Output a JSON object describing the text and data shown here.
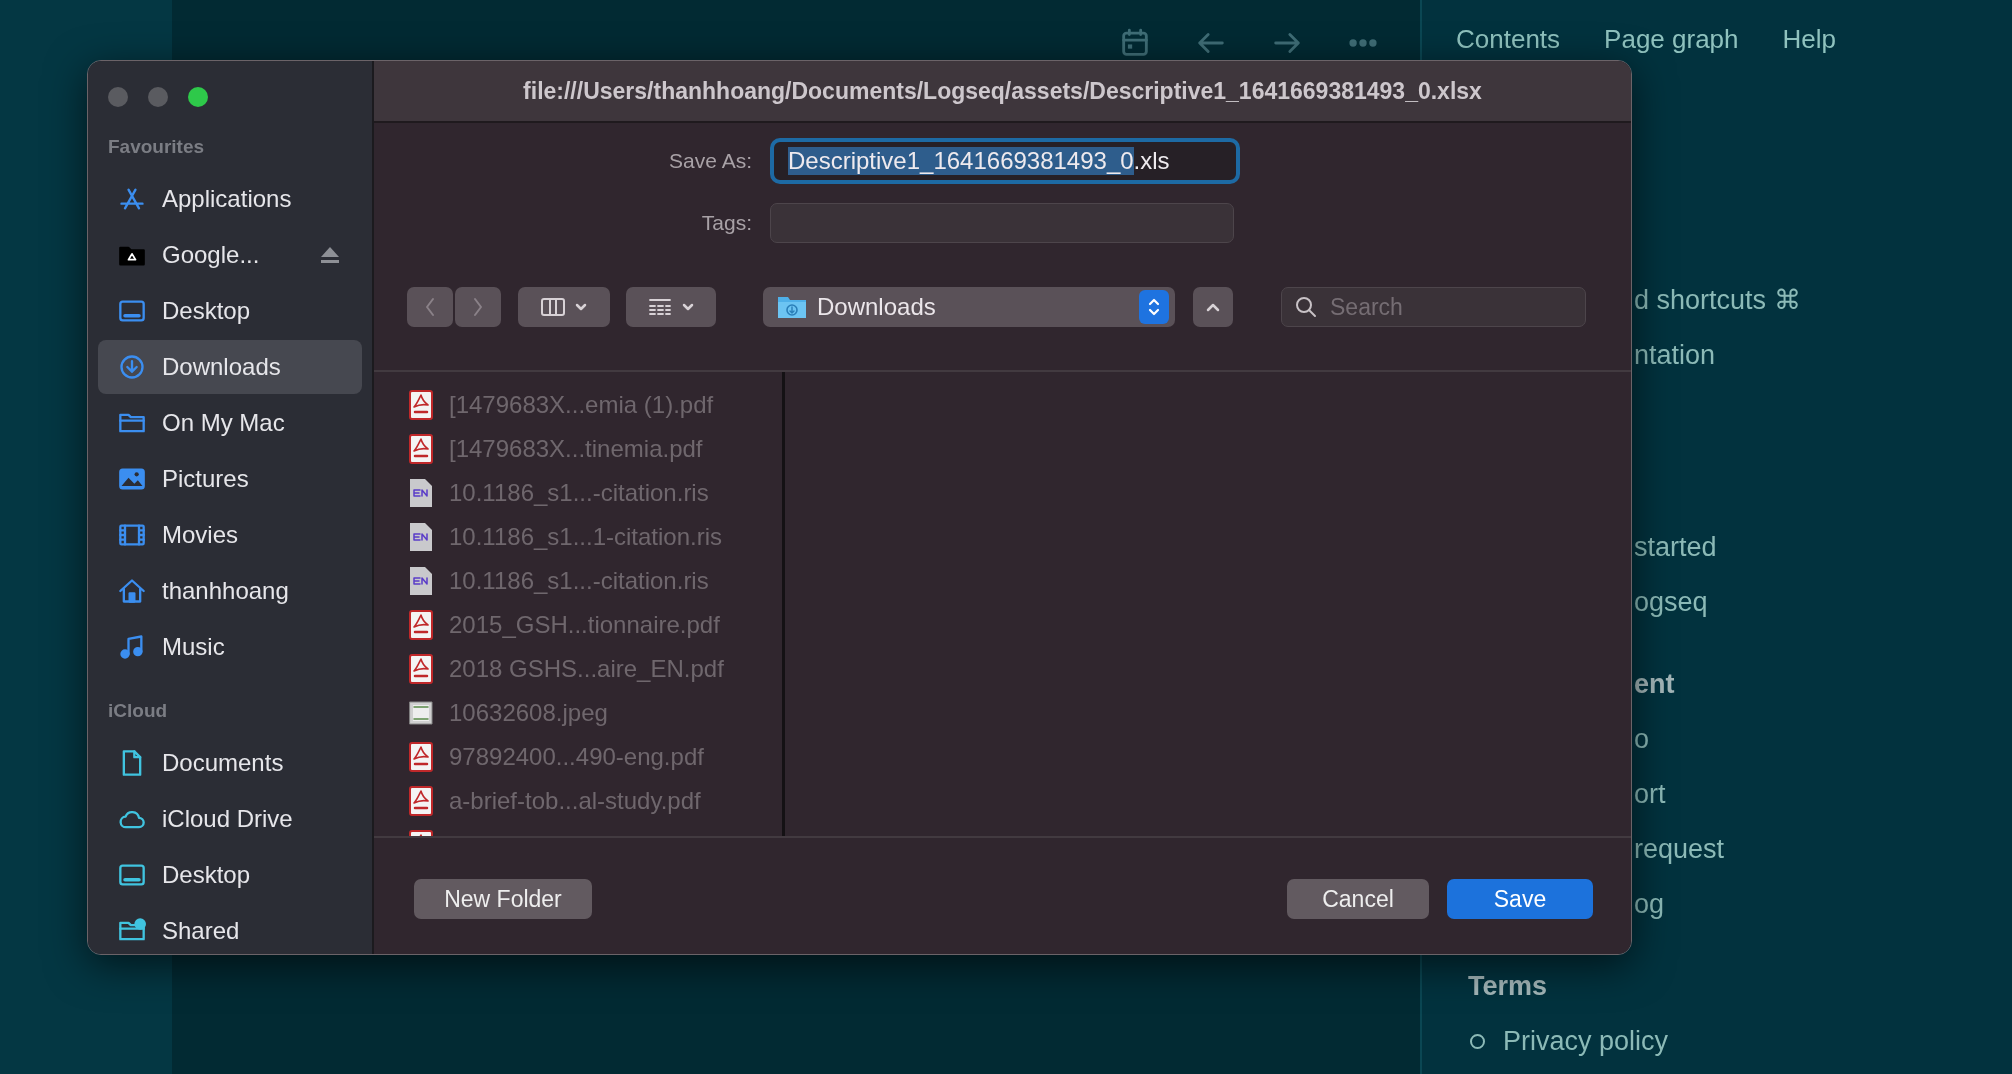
{
  "app_nav": [
    "Contents",
    "Page graph",
    "Help"
  ],
  "help_panel": {
    "sections": [
      {
        "items": [
          {
            "text": "d shortcuts ⌘",
            "kind": "partial"
          },
          {
            "text": "ntation",
            "kind": "partial"
          }
        ]
      },
      {
        "items": [
          {
            "text": "started",
            "kind": "partial"
          },
          {
            "text": "ogseq",
            "kind": "partial"
          }
        ]
      },
      {
        "heading": {
          "text": "ent",
          "kind": "partial"
        },
        "items": [
          {
            "text": "o",
            "kind": "partial"
          },
          {
            "text": "ort",
            "kind": "partial"
          },
          {
            "text": "request",
            "kind": "partial"
          },
          {
            "text": "og",
            "kind": "partial"
          }
        ]
      },
      {
        "heading": {
          "text": "Terms",
          "kind": "full"
        },
        "items": [
          {
            "text": "Privacy policy",
            "kind": "bullet"
          }
        ]
      }
    ]
  },
  "dialog": {
    "title": "file:///Users/thanhhoang/Documents/Logseq/assets/Descriptive1_1641669381493_0.xlsx",
    "sidebar": [
      {
        "title": "Favourites",
        "items": [
          {
            "label": "Applications",
            "kind": "apps",
            "selected": false
          },
          {
            "label": "Google...",
            "kind": "drive",
            "selected": false,
            "eject": true
          },
          {
            "label": "Desktop",
            "kind": "desktop",
            "selected": false
          },
          {
            "label": "Downloads",
            "kind": "downloads",
            "selected": true
          },
          {
            "label": "On My Mac",
            "kind": "folder",
            "selected": false
          },
          {
            "label": "Pictures",
            "kind": "pictures",
            "selected": false
          },
          {
            "label": "Movies",
            "kind": "movies",
            "selected": false
          },
          {
            "label": "thanhhoang",
            "kind": "home",
            "selected": false
          },
          {
            "label": "Music",
            "kind": "music",
            "selected": false
          }
        ]
      },
      {
        "title": "iCloud",
        "items": [
          {
            "label": "Documents",
            "kind": "document",
            "selected": false
          },
          {
            "label": "iCloud Drive",
            "kind": "cloud",
            "selected": false
          },
          {
            "label": "Desktop",
            "kind": "desktop",
            "selected": false
          },
          {
            "label": "Shared",
            "kind": "shared",
            "selected": false
          }
        ]
      }
    ],
    "save_as": {
      "label": "Save As:",
      "selected_text": "Descriptive1_1641669381493_0",
      "value_rest": ".xls"
    },
    "tags": {
      "label": "Tags:"
    },
    "location": "Downloads",
    "search": {
      "placeholder": "Search"
    },
    "files": [
      {
        "kind": "pdf",
        "name": "[1479683X...emia (1).pdf",
        "disabled": true
      },
      {
        "kind": "pdf",
        "name": "[1479683X...tinemia.pdf",
        "disabled": true
      },
      {
        "kind": "ris",
        "name": "10.1186_s1...-citation.ris",
        "disabled": true
      },
      {
        "kind": "ris",
        "name": "10.1186_s1...1-citation.ris",
        "disabled": true
      },
      {
        "kind": "ris",
        "name": "10.1186_s1...-citation.ris",
        "disabled": true
      },
      {
        "kind": "pdf",
        "name": "2015_GSH...tionnaire.pdf",
        "disabled": true
      },
      {
        "kind": "pdf",
        "name": "2018 GSHS...aire_EN.pdf",
        "disabled": true
      },
      {
        "kind": "jpeg",
        "name": "10632608.jpeg",
        "disabled": true
      },
      {
        "kind": "pdf",
        "name": "97892400...490-eng.pdf",
        "disabled": true
      },
      {
        "kind": "pdf",
        "name": "a-brief-tob...al-study.pdf",
        "disabled": true
      },
      {
        "kind": "pdf"
      }
    ],
    "buttons": [
      {
        "label": "New Folder",
        "kind": "secondary"
      },
      {
        "label": "Cancel",
        "kind": "secondary"
      },
      {
        "label": "Save",
        "kind": "primary"
      }
    ]
  }
}
